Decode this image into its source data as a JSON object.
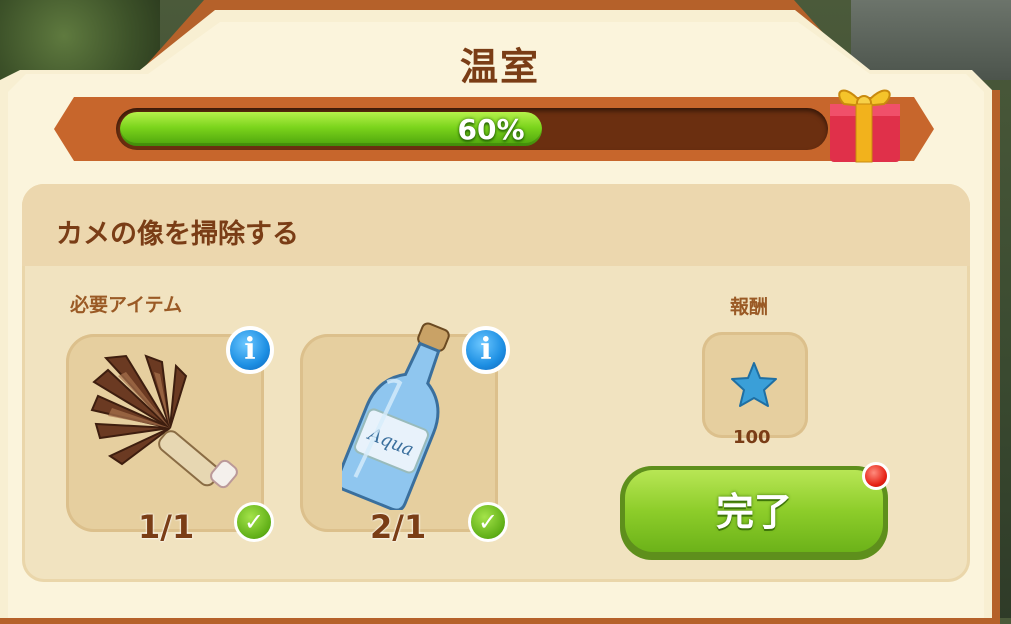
{
  "header": {
    "title": "温室"
  },
  "progress": {
    "value": 0.6,
    "label": "60%"
  },
  "task": {
    "title": "カメの像を掃除する"
  },
  "requirements": {
    "label": "必要アイテム",
    "items": [
      {
        "icon": "feather-duster-icon",
        "count": "1/1",
        "complete": true
      },
      {
        "icon": "aqua-bottle-icon",
        "bottle_label": "Aqua",
        "count": "2/1",
        "complete": true
      }
    ]
  },
  "reward": {
    "label": "報酬",
    "icon": "blue-star-icon",
    "value": "100"
  },
  "actions": {
    "complete_label": "完了"
  },
  "colors": {
    "title_brown": "#7a3d16",
    "progress_green": "#7bd41c",
    "button_green": "#8dcd2a",
    "info_blue": "#1d8fe3",
    "notification_red": "#e51f12"
  }
}
